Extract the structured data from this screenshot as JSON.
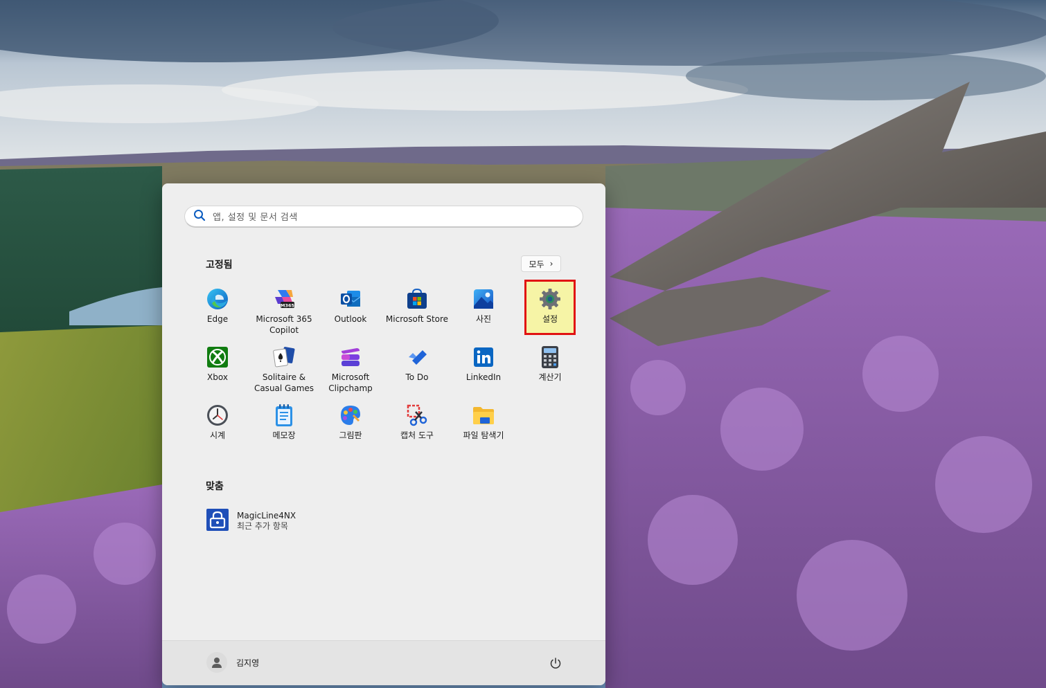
{
  "search": {
    "placeholder": "앱, 설정 및 문서 검색"
  },
  "pinned": {
    "title": "고정됨",
    "all_button": "모두",
    "apps": [
      {
        "label": "Edge",
        "icon": "edge-icon"
      },
      {
        "label": "Microsoft 365\nCopilot",
        "icon": "m365-copilot-icon"
      },
      {
        "label": "Outlook",
        "icon": "outlook-icon"
      },
      {
        "label": "Microsoft Store",
        "icon": "store-icon"
      },
      {
        "label": "사진",
        "icon": "photos-icon"
      },
      {
        "label": "설정",
        "icon": "settings-gear-icon",
        "highlighted": true
      },
      {
        "label": "Xbox",
        "icon": "xbox-icon"
      },
      {
        "label": "Solitaire &\nCasual Games",
        "icon": "solitaire-icon"
      },
      {
        "label": "Microsoft\nClipchamp",
        "icon": "clipchamp-icon"
      },
      {
        "label": "To Do",
        "icon": "todo-icon"
      },
      {
        "label": "LinkedIn",
        "icon": "linkedin-icon"
      },
      {
        "label": "계산기",
        "icon": "calculator-icon"
      },
      {
        "label": "시계",
        "icon": "clock-icon"
      },
      {
        "label": "메모장",
        "icon": "notepad-icon"
      },
      {
        "label": "그림판",
        "icon": "paint-icon"
      },
      {
        "label": "캡처 도구",
        "icon": "snipping-tool-icon"
      },
      {
        "label": "파일 탐색기",
        "icon": "file-explorer-icon"
      }
    ]
  },
  "recommended": {
    "title": "맞춤",
    "items": [
      {
        "name": "MagicLine4NX",
        "subtitle": "최근 추가 항목",
        "icon": "magicline-lock-icon"
      }
    ]
  },
  "footer": {
    "user_name": "김지영"
  },
  "colors": {
    "highlight_border": "#e11212",
    "highlight_fill": "#f6f4a6",
    "menu_bg": "#eeeeee"
  }
}
